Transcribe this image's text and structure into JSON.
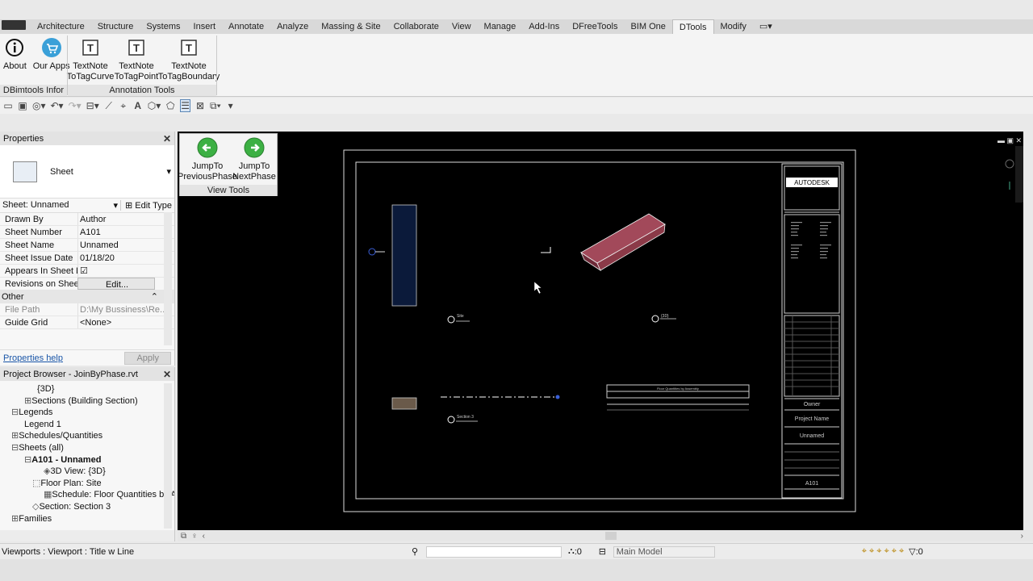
{
  "tabs": [
    "Architecture",
    "Structure",
    "Systems",
    "Insert",
    "Annotate",
    "Analyze",
    "Massing & Site",
    "Collaborate",
    "View",
    "Manage",
    "Add-Ins",
    "DFreeTools",
    "BIM One",
    "DTools",
    "Modify"
  ],
  "active_tab": "DTools",
  "ribbon": {
    "about": "About",
    "our_apps": "Our Apps",
    "tn_curve_1": "TextNote",
    "tn_curve_2": "ToTagCurve",
    "tn_point_1": "TextNote",
    "tn_point_2": "ToTagPoint",
    "tn_boundary_1": "TextNote",
    "tn_boundary_2": "ToTagBoundary",
    "panel_info": "DBimtools Infor",
    "panel_annotation": "Annotation Tools"
  },
  "properties": {
    "title": "Properties",
    "type": "Sheet",
    "selector": "Sheet: Unnamed",
    "edit_type": "Edit Type",
    "rows": [
      {
        "k": "Drawn By",
        "v": "Author"
      },
      {
        "k": "Sheet Number",
        "v": "A101"
      },
      {
        "k": "Sheet Name",
        "v": "Unnamed"
      },
      {
        "k": "Sheet Issue Date",
        "v": "01/18/20"
      },
      {
        "k": "Appears In Sheet L...",
        "v": "☑"
      },
      {
        "k": "Revisions on Sheet",
        "v": "Edit..."
      }
    ],
    "group_other": "Other",
    "rows2": [
      {
        "k": "File Path",
        "v": "D:\\My Bussiness\\Re..."
      },
      {
        "k": "Guide Grid",
        "v": "<None>"
      }
    ],
    "help": "Properties help",
    "apply": "Apply"
  },
  "browser": {
    "title": "Project Browser - JoinByPhase.rvt",
    "items": [
      "{3D}",
      "Sections (Building Section)",
      "Legends",
      "Legend 1",
      "Schedules/Quantities",
      "Sheets (all)",
      "A101 - Unnamed",
      "3D View: {3D}",
      "Floor Plan: Site",
      "Schedule: Floor Quantities by As",
      "Section: Section 3",
      "Families"
    ]
  },
  "view_tools": {
    "prev_1": "JumpTo",
    "prev_2": "PreviousPhase",
    "next_1": "JumpTo",
    "next_2": "NextPhase",
    "label": "View Tools"
  },
  "sheet": {
    "brand": "AUTODESK",
    "owner": "Owner",
    "project": "Project Name",
    "name": "Unnamed",
    "number": "A101",
    "label_site": "Site",
    "label_3d": "{3D}",
    "label_section": "Section 3",
    "schedule_title": "Floor Quantities by Assembly"
  },
  "status": {
    "text": "Viewports : Viewport : Title w Line",
    "sel_count": ":0",
    "model": "Main Model",
    "filter": ":0"
  },
  "colors": {
    "canvas": "#000000",
    "box": "#8b3a48",
    "active_tab": "#f4f4f4"
  }
}
